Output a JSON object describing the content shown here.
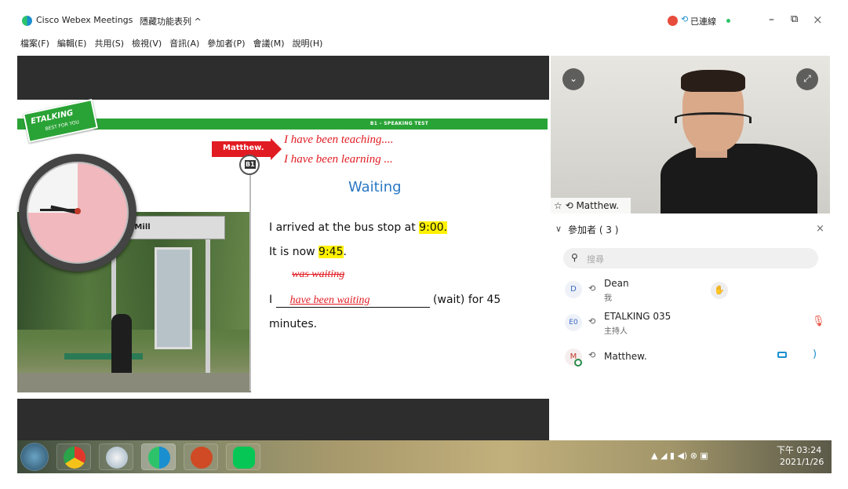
{
  "window": {
    "app_title": "Cisco Webex Meetings",
    "hidden_features": "隱藏功能表列 ^",
    "connection": "已連線",
    "controls": {
      "minimize": "–",
      "restore": "⧉",
      "close": "×"
    }
  },
  "menu": [
    "檔案(F)",
    "編輯(E)",
    "共用(S)",
    "檢視(V)",
    "音訊(A)",
    "參加者(P)",
    "會議(M)",
    "說明(H)"
  ],
  "slide": {
    "logo_text": "ETALKING",
    "logo_sub": "BEST FOR YOU",
    "banner": "B1 – SPEAKING TEST",
    "name_tag": "Matthew.",
    "badge": "B1",
    "line1": "I have been teaching....",
    "line2": "I have been learning ...",
    "heading": "Waiting",
    "s1_prefix": "I arrived at the bus stop at ",
    "s1_time": "9:00.",
    "s2_prefix": "It is now ",
    "s2_time": "9:45",
    "s2_suffix": ".",
    "crossed": "was waiting",
    "s3_i": "I",
    "s3_answer": "have been waiting",
    "s3_rest": "(wait) for 45",
    "s3_end": "minutes.",
    "bus_sign": "s Mill"
  },
  "video": {
    "name": "Matthew."
  },
  "participants": {
    "header": "參加者 ( 3 )",
    "search_placeholder": "搜尋",
    "list": [
      {
        "initials": "D",
        "name": "Dean",
        "role": "我"
      },
      {
        "initials": "E0",
        "name": "ETALKING 035",
        "role": "主持人"
      },
      {
        "initials": "M",
        "name": "Matthew.",
        "role": ""
      }
    ]
  },
  "taskbar": {
    "clock_time": "下午 03:24",
    "clock_date": "2021/1/26",
    "colors": {
      "chrome": "#e2382b",
      "ppt": "#d04a25",
      "line": "#06c755",
      "webex": "#1a8fd0"
    }
  }
}
